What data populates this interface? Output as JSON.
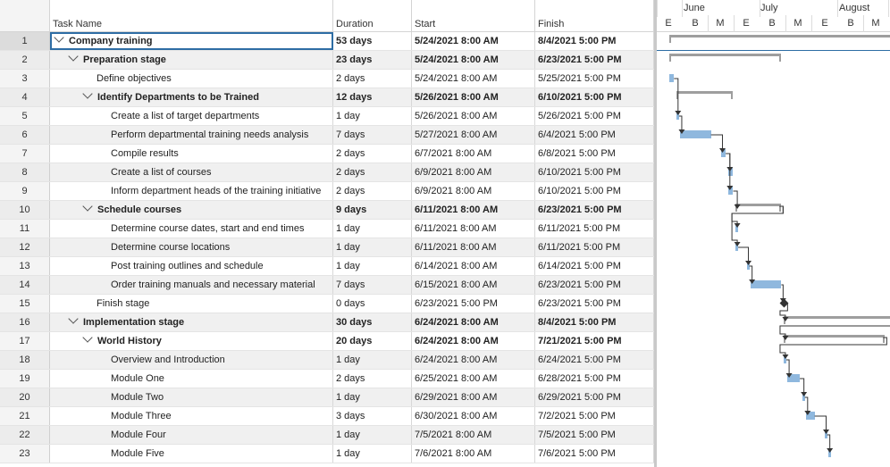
{
  "columns": {
    "task_name": "Task Name",
    "duration": "Duration",
    "start": "Start",
    "finish": "Finish"
  },
  "timeline": {
    "months": [
      "June",
      "July",
      "August"
    ],
    "week_labels": [
      "E",
      "B",
      "M",
      "E",
      "B",
      "M",
      "E",
      "B",
      "M"
    ]
  },
  "colors": {
    "task_bar": "#8fb8de",
    "summary_bar": "#9e9e9e",
    "selection": "#2e6da4"
  },
  "tasks": [
    {
      "id": "1",
      "name": "Company training",
      "duration": "53 days",
      "start": "5/24/2021 8:00 AM",
      "finish": "8/4/2021 5:00 PM",
      "level": 0,
      "summary": true
    },
    {
      "id": "2",
      "name": "Preparation stage",
      "duration": "23 days",
      "start": "5/24/2021 8:00 AM",
      "finish": "6/23/2021 5:00 PM",
      "level": 1,
      "summary": true
    },
    {
      "id": "3",
      "name": "Define objectives",
      "duration": "2 days",
      "start": "5/24/2021 8:00 AM",
      "finish": "5/25/2021 5:00 PM",
      "level": 2,
      "summary": false
    },
    {
      "id": "4",
      "name": "Identify Departments to be Trained",
      "duration": "12 days",
      "start": "5/26/2021 8:00 AM",
      "finish": "6/10/2021 5:00 PM",
      "level": 2,
      "summary": true
    },
    {
      "id": "5",
      "name": "Create a list of target departments",
      "duration": "1 day",
      "start": "5/26/2021 8:00 AM",
      "finish": "5/26/2021 5:00 PM",
      "level": 3,
      "summary": false
    },
    {
      "id": "6",
      "name": "Perform departmental training needs analysis",
      "duration": "7 days",
      "start": "5/27/2021 8:00 AM",
      "finish": "6/4/2021 5:00 PM",
      "level": 3,
      "summary": false
    },
    {
      "id": "7",
      "name": "Compile results",
      "duration": "2 days",
      "start": "6/7/2021 8:00 AM",
      "finish": "6/8/2021 5:00 PM",
      "level": 3,
      "summary": false
    },
    {
      "id": "8",
      "name": "Create a list of courses",
      "duration": "2 days",
      "start": "6/9/2021 8:00 AM",
      "finish": "6/10/2021 5:00 PM",
      "level": 3,
      "summary": false
    },
    {
      "id": "9",
      "name": "Inform department heads of the training initiative",
      "duration": "2 days",
      "start": "6/9/2021 8:00 AM",
      "finish": "6/10/2021 5:00 PM",
      "level": 3,
      "summary": false
    },
    {
      "id": "10",
      "name": "Schedule courses",
      "duration": "9 days",
      "start": "6/11/2021 8:00 AM",
      "finish": "6/23/2021 5:00 PM",
      "level": 2,
      "summary": true
    },
    {
      "id": "11",
      "name": "Determine course dates, start and end times",
      "duration": "1 day",
      "start": "6/11/2021 8:00 AM",
      "finish": "6/11/2021 5:00 PM",
      "level": 3,
      "summary": false
    },
    {
      "id": "12",
      "name": "Determine course locations",
      "duration": "1 day",
      "start": "6/11/2021 8:00 AM",
      "finish": "6/11/2021 5:00 PM",
      "level": 3,
      "summary": false
    },
    {
      "id": "13",
      "name": "Post training outlines and schedule",
      "duration": "1 day",
      "start": "6/14/2021 8:00 AM",
      "finish": "6/14/2021 5:00 PM",
      "level": 3,
      "summary": false
    },
    {
      "id": "14",
      "name": "Order training manuals and necessary material",
      "duration": "7 days",
      "start": "6/15/2021 8:00 AM",
      "finish": "6/23/2021 5:00 PM",
      "level": 3,
      "summary": false
    },
    {
      "id": "15",
      "name": "Finish stage",
      "duration": "0 days",
      "start": "6/23/2021 5:00 PM",
      "finish": "6/23/2021 5:00 PM",
      "level": 2,
      "summary": false,
      "milestone": true
    },
    {
      "id": "16",
      "name": "Implementation stage",
      "duration": "30 days",
      "start": "6/24/2021 8:00 AM",
      "finish": "8/4/2021 5:00 PM",
      "level": 1,
      "summary": true
    },
    {
      "id": "17",
      "name": "World History",
      "duration": "20 days",
      "start": "6/24/2021 8:00 AM",
      "finish": "7/21/2021 5:00 PM",
      "level": 2,
      "summary": true
    },
    {
      "id": "18",
      "name": "Overview and Introduction",
      "duration": "1 day",
      "start": "6/24/2021 8:00 AM",
      "finish": "6/24/2021 5:00 PM",
      "level": 3,
      "summary": false
    },
    {
      "id": "19",
      "name": "Module One",
      "duration": "2 days",
      "start": "6/25/2021 8:00 AM",
      "finish": "6/28/2021 5:00 PM",
      "level": 3,
      "summary": false
    },
    {
      "id": "20",
      "name": "Module Two",
      "duration": "1 day",
      "start": "6/29/2021 8:00 AM",
      "finish": "6/29/2021 5:00 PM",
      "level": 3,
      "summary": false
    },
    {
      "id": "21",
      "name": "Module Three",
      "duration": "3 days",
      "start": "6/30/2021 8:00 AM",
      "finish": "7/2/2021 5:00 PM",
      "level": 3,
      "summary": false
    },
    {
      "id": "22",
      "name": "Module Four",
      "duration": "1 day",
      "start": "7/5/2021 8:00 AM",
      "finish": "7/5/2021 5:00 PM",
      "level": 3,
      "summary": false
    },
    {
      "id": "23",
      "name": "Module Five",
      "duration": "1 day",
      "start": "7/6/2021 8:00 AM",
      "finish": "7/6/2021 5:00 PM",
      "level": 3,
      "summary": false
    }
  ]
}
